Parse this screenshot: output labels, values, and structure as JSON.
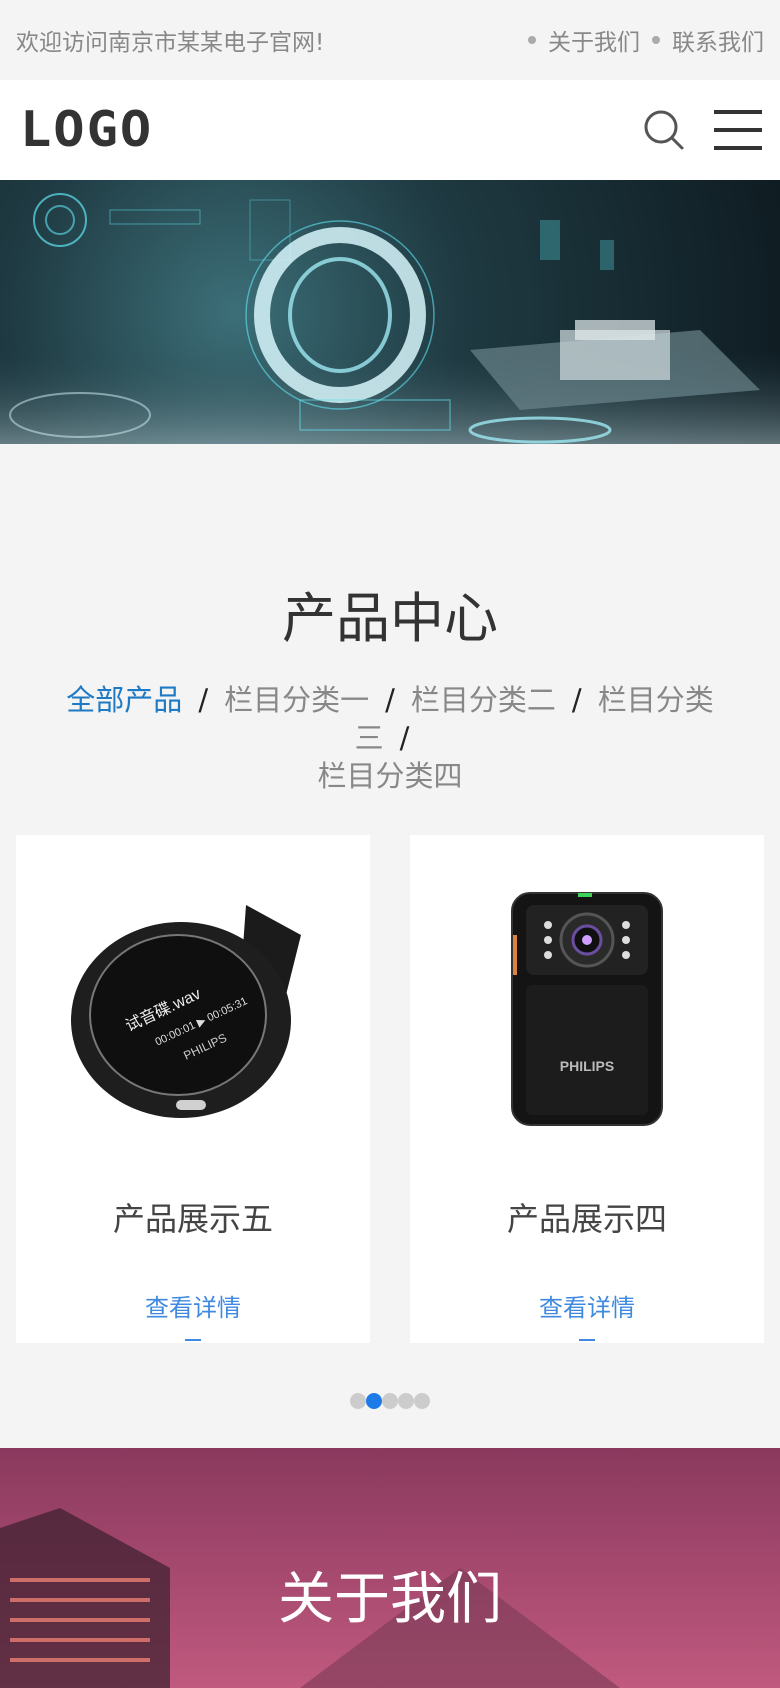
{
  "topbar": {
    "welcome": "欢迎访问南京市某某电子官网!",
    "links": [
      {
        "label": "关于我们"
      },
      {
        "label": "联系我们"
      }
    ]
  },
  "header": {
    "logo": "LOGO",
    "search_icon": "search-icon",
    "menu_icon": "menu-icon"
  },
  "products": {
    "title": "产品中心",
    "categories": [
      {
        "label": "全部产品",
        "active": true
      },
      {
        "label": "栏目分类一"
      },
      {
        "label": "栏目分类二"
      },
      {
        "label": "栏目分类三"
      },
      {
        "label": "栏目分类四"
      }
    ],
    "items": [
      {
        "title": "产品展示五",
        "link": "查看详情",
        "device_text": "PHILIPS"
      },
      {
        "title": "产品展示四",
        "link": "查看详情",
        "device_text": "PHILIPS"
      }
    ],
    "pager": {
      "count": 5,
      "active": 1
    }
  },
  "about": {
    "title": "关于我们"
  },
  "colors": {
    "accent": "#1e7ac4",
    "link": "#3f8ae0"
  }
}
